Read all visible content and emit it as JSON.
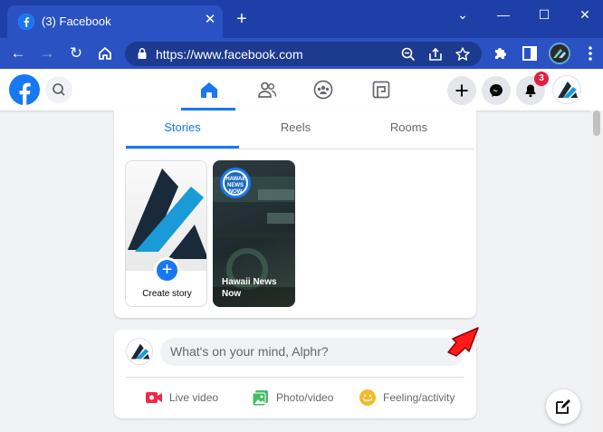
{
  "browser": {
    "tab_title": "(3) Facebook",
    "url": "https://www.facebook.com",
    "accent_color": "#2a52c2"
  },
  "facebook": {
    "brand_color": "#1877f2",
    "notification_count": "3",
    "nav_tabs": [
      "home-icon",
      "friends-icon",
      "groups-icon",
      "gaming-icon"
    ]
  },
  "stories": {
    "tabs": [
      "Stories",
      "Reels",
      "Rooms"
    ],
    "create_label": "Create story",
    "news_story": {
      "logo_lines": [
        "HAWAII",
        "NEWS",
        "NOW"
      ],
      "title": "Hawaii News Now"
    }
  },
  "composer": {
    "placeholder": "What's on your mind, Alphr?",
    "actions": [
      {
        "label": "Live video",
        "icon": "live-video-icon",
        "color": "#f02849"
      },
      {
        "label": "Photo/video",
        "icon": "photo-video-icon",
        "color": "#45bd62"
      },
      {
        "label": "Feeling/activity",
        "icon": "feeling-icon",
        "color": "#f7b928"
      }
    ]
  }
}
